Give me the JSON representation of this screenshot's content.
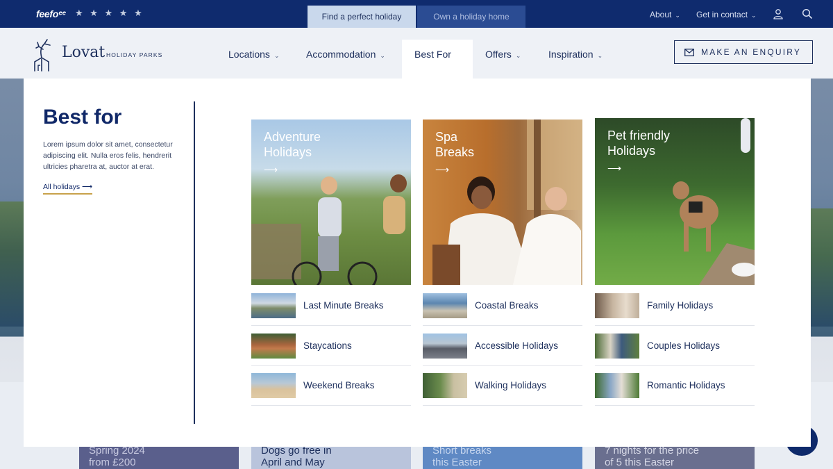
{
  "topbar": {
    "brand": "feefo",
    "brand_suffix": "ᵉᵉ",
    "stars": "★ ★ ★ ★ ★",
    "tabs": [
      {
        "label": "Find a perfect holiday",
        "active": true
      },
      {
        "label": "Own a holiday home",
        "active": false
      }
    ],
    "links": [
      {
        "label": "About"
      },
      {
        "label": "Get in contact"
      }
    ],
    "icons": [
      "user-icon",
      "search-icon"
    ]
  },
  "header": {
    "logo_name": "Lovat",
    "logo_sub": "HOLIDAY PARKS",
    "nav": [
      {
        "label": "Locations",
        "has_dropdown": true
      },
      {
        "label": "Accommodation",
        "has_dropdown": true
      },
      {
        "label": "Best For",
        "active": true
      },
      {
        "label": "Offers",
        "has_dropdown": true
      },
      {
        "label": "Inspiration",
        "has_dropdown": true
      }
    ],
    "enquiry_label": "MAKE AN ENQUIRY"
  },
  "menu": {
    "title": "Best for",
    "description": "Lorem ipsum dolor sit amet, consectetur adipiscing elit. Nulla eros felis, hendrerit ultricies pharetra at, auctor at erat.",
    "all_link": "All holidays",
    "columns": [
      {
        "feature": {
          "title_line1": "Adventure",
          "title_line2": "Holidays"
        },
        "items": [
          "Last Minute Breaks",
          "Staycations",
          "Weekend Breaks"
        ]
      },
      {
        "feature": {
          "title_line1": "Spa",
          "title_line2": "Breaks"
        },
        "items": [
          "Coastal Breaks",
          "Accessible Holidays",
          "Walking Holidays"
        ]
      },
      {
        "feature": {
          "title_line1": "Pet friendly",
          "title_line2": "Holidays"
        },
        "items": [
          "Family Holidays",
          "Couples Holidays",
          "Romantic Holidays"
        ]
      }
    ]
  },
  "teasers": [
    {
      "line1": "Spring 2024",
      "line2": "from £200"
    },
    {
      "line1": "Dogs go free in",
      "line2": "April and May"
    },
    {
      "line1": "Short breaks",
      "line2": "this Easter"
    },
    {
      "line1": "7 nights for the price",
      "line2": "of 5 this Easter"
    }
  ],
  "colors": {
    "navy": "#0f2b6e",
    "text": "#1d2f5c",
    "accent_gold": "#c8a24a"
  }
}
